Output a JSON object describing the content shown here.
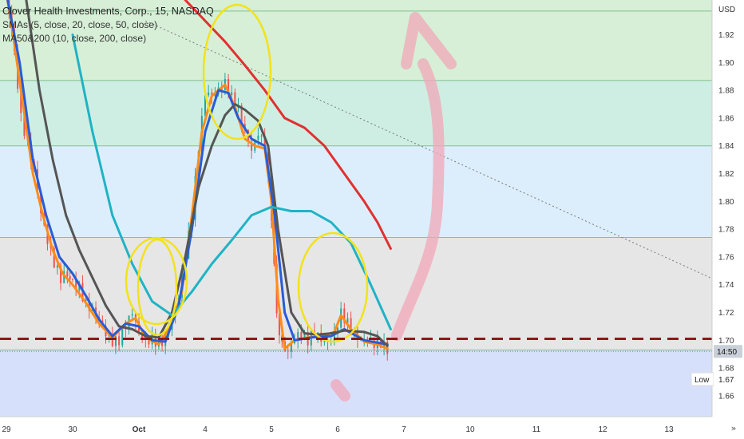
{
  "legend": {
    "symbol_line": "Clover Health Investments, Corp., 15, NASDAQ",
    "sma_line": "SMAs (5, close, 20, close, 50, close)",
    "ma_line": "MA50&200 (10, close, 200, close)"
  },
  "chart_data": {
    "type": "candlestick",
    "symbol": "Clover Health Investments, Corp.",
    "interval": "15",
    "exchange": "NASDAQ",
    "currency_label": "USD",
    "ylim": [
      1.645,
      1.945
    ],
    "y_ticks": [
      1.66,
      1.68,
      1.7,
      1.72,
      1.74,
      1.76,
      1.78,
      1.8,
      1.82,
      1.84,
      1.86,
      1.88,
      1.9,
      1.92
    ],
    "x_ticks": [
      {
        "label": "29",
        "day": 0,
        "bold": false
      },
      {
        "label": "30",
        "day": 1,
        "bold": false
      },
      {
        "label": "Oct",
        "day": 2,
        "bold": true
      },
      {
        "label": "4",
        "day": 3,
        "bold": false
      },
      {
        "label": "5",
        "day": 4,
        "bold": false
      },
      {
        "label": "6",
        "day": 5,
        "bold": false
      },
      {
        "label": "7",
        "day": 6,
        "bold": false
      },
      {
        "label": "10",
        "day": 7,
        "bold": false
      },
      {
        "label": "11",
        "day": 8,
        "bold": false
      },
      {
        "label": "12",
        "day": 9,
        "bold": false
      },
      {
        "label": "13",
        "day": 10,
        "bold": false
      }
    ],
    "zones": [
      {
        "from": 1.887,
        "to": 1.945,
        "color": "#d6efd6"
      },
      {
        "from": 1.84,
        "to": 1.887,
        "color": "#cfeee3"
      },
      {
        "from": 1.774,
        "to": 1.84,
        "color": "#dceefb"
      },
      {
        "from": 1.693,
        "to": 1.774,
        "color": "#e6e6e6"
      },
      {
        "from": 1.645,
        "to": 1.693,
        "color": "#d6e0fb"
      }
    ],
    "zone_lines": [
      1.937,
      1.887,
      1.84,
      1.774,
      1.693
    ],
    "support_level": 1.701,
    "current_price_label": "14:50",
    "current_price": 1.692,
    "low_label": "Low",
    "low_value": "1.67",
    "low_price": 1.672,
    "close_series": [
      [
        0.0,
        1.95
      ],
      [
        0.12,
        1.91
      ],
      [
        0.22,
        1.86
      ],
      [
        0.32,
        1.84
      ],
      [
        0.42,
        1.82
      ],
      [
        0.52,
        1.79
      ],
      [
        0.62,
        1.77
      ],
      [
        0.72,
        1.755
      ],
      [
        0.82,
        1.745
      ],
      [
        0.92,
        1.75
      ],
      [
        1.0,
        1.742
      ],
      [
        1.1,
        1.738
      ],
      [
        1.2,
        1.725
      ],
      [
        1.3,
        1.72
      ],
      [
        1.4,
        1.712
      ],
      [
        1.5,
        1.703
      ],
      [
        1.6,
        1.698
      ],
      [
        1.7,
        1.7
      ],
      [
        1.8,
        1.712
      ],
      [
        1.9,
        1.722
      ],
      [
        2.0,
        1.708
      ],
      [
        2.1,
        1.7
      ],
      [
        2.2,
        1.702
      ],
      [
        2.3,
        1.696
      ],
      [
        2.4,
        1.7
      ],
      [
        2.5,
        1.715
      ],
      [
        2.6,
        1.73
      ],
      [
        2.7,
        1.76
      ],
      [
        2.8,
        1.79
      ],
      [
        2.9,
        1.84
      ],
      [
        3.0,
        1.88
      ],
      [
        3.1,
        1.878
      ],
      [
        3.2,
        1.882
      ],
      [
        3.3,
        1.886
      ],
      [
        3.4,
        1.875
      ],
      [
        3.5,
        1.865
      ],
      [
        3.6,
        1.848
      ],
      [
        3.7,
        1.835
      ],
      [
        3.8,
        1.848
      ],
      [
        3.9,
        1.838
      ],
      [
        4.0,
        1.79
      ],
      [
        4.08,
        1.72
      ],
      [
        4.16,
        1.695
      ],
      [
        4.25,
        1.69
      ],
      [
        4.35,
        1.7
      ],
      [
        4.45,
        1.704
      ],
      [
        4.55,
        1.7
      ],
      [
        4.65,
        1.708
      ],
      [
        4.75,
        1.702
      ],
      [
        4.85,
        1.7
      ],
      [
        4.95,
        1.706
      ],
      [
        5.05,
        1.72
      ],
      [
        5.15,
        1.712
      ],
      [
        5.25,
        1.702
      ],
      [
        5.35,
        1.698
      ],
      [
        5.45,
        1.7
      ],
      [
        5.55,
        1.696
      ],
      [
        5.65,
        1.698
      ],
      [
        5.75,
        1.694
      ]
    ],
    "series": [
      {
        "name": "SMA 5",
        "color": "#ff8c1a",
        "points": [
          [
            0.0,
            1.95
          ],
          [
            0.1,
            1.92
          ],
          [
            0.25,
            1.87
          ],
          [
            0.4,
            1.82
          ],
          [
            0.55,
            1.79
          ],
          [
            0.7,
            1.765
          ],
          [
            0.85,
            1.748
          ],
          [
            1.0,
            1.74
          ],
          [
            1.2,
            1.727
          ],
          [
            1.4,
            1.712
          ],
          [
            1.6,
            1.702
          ],
          [
            1.8,
            1.712
          ],
          [
            1.95,
            1.716
          ],
          [
            2.1,
            1.702
          ],
          [
            2.3,
            1.697
          ],
          [
            2.5,
            1.712
          ],
          [
            2.65,
            1.735
          ],
          [
            2.8,
            1.79
          ],
          [
            2.95,
            1.85
          ],
          [
            3.1,
            1.876
          ],
          [
            3.3,
            1.884
          ],
          [
            3.45,
            1.868
          ],
          [
            3.6,
            1.845
          ],
          [
            3.75,
            1.84
          ],
          [
            3.9,
            1.838
          ],
          [
            4.0,
            1.8
          ],
          [
            4.1,
            1.73
          ],
          [
            4.2,
            1.694
          ],
          [
            4.35,
            1.7
          ],
          [
            4.55,
            1.702
          ],
          [
            4.75,
            1.703
          ],
          [
            4.95,
            1.706
          ],
          [
            5.05,
            1.718
          ],
          [
            5.2,
            1.708
          ],
          [
            5.4,
            1.699
          ],
          [
            5.6,
            1.697
          ],
          [
            5.75,
            1.694
          ]
        ]
      },
      {
        "name": "SMA 20",
        "color": "#2a5bd7",
        "points": [
          [
            0.0,
            1.95
          ],
          [
            0.2,
            1.9
          ],
          [
            0.4,
            1.83
          ],
          [
            0.6,
            1.79
          ],
          [
            0.8,
            1.76
          ],
          [
            1.0,
            1.748
          ],
          [
            1.2,
            1.732
          ],
          [
            1.4,
            1.715
          ],
          [
            1.6,
            1.703
          ],
          [
            1.8,
            1.712
          ],
          [
            2.0,
            1.71
          ],
          [
            2.2,
            1.7
          ],
          [
            2.4,
            1.699
          ],
          [
            2.6,
            1.725
          ],
          [
            2.8,
            1.78
          ],
          [
            3.0,
            1.85
          ],
          [
            3.2,
            1.88
          ],
          [
            3.35,
            1.878
          ],
          [
            3.5,
            1.86
          ],
          [
            3.7,
            1.845
          ],
          [
            3.9,
            1.84
          ],
          [
            4.05,
            1.79
          ],
          [
            4.2,
            1.72
          ],
          [
            4.35,
            1.7
          ],
          [
            4.6,
            1.702
          ],
          [
            4.9,
            1.703
          ],
          [
            5.1,
            1.708
          ],
          [
            5.4,
            1.7
          ],
          [
            5.75,
            1.697
          ]
        ]
      },
      {
        "name": "SMA 50",
        "color": "#555555",
        "points": [
          [
            0.3,
            1.945
          ],
          [
            0.5,
            1.88
          ],
          [
            0.7,
            1.83
          ],
          [
            0.9,
            1.79
          ],
          [
            1.1,
            1.765
          ],
          [
            1.3,
            1.745
          ],
          [
            1.5,
            1.725
          ],
          [
            1.7,
            1.71
          ],
          [
            1.9,
            1.708
          ],
          [
            2.1,
            1.703
          ],
          [
            2.3,
            1.702
          ],
          [
            2.5,
            1.72
          ],
          [
            2.7,
            1.76
          ],
          [
            2.9,
            1.81
          ],
          [
            3.1,
            1.84
          ],
          [
            3.3,
            1.862
          ],
          [
            3.45,
            1.87
          ],
          [
            3.6,
            1.866
          ],
          [
            3.8,
            1.858
          ],
          [
            3.95,
            1.84
          ],
          [
            4.1,
            1.78
          ],
          [
            4.3,
            1.72
          ],
          [
            4.5,
            1.705
          ],
          [
            4.7,
            1.704
          ],
          [
            4.9,
            1.705
          ],
          [
            5.1,
            1.707
          ],
          [
            5.4,
            1.706
          ],
          [
            5.6,
            1.703
          ],
          [
            5.75,
            1.696
          ]
        ]
      },
      {
        "name": "MA 10",
        "color": "#1fb3c4",
        "points": [
          [
            1.0,
            1.92
          ],
          [
            1.3,
            1.85
          ],
          [
            1.6,
            1.79
          ],
          [
            1.9,
            1.755
          ],
          [
            2.2,
            1.728
          ],
          [
            2.5,
            1.718
          ],
          [
            2.8,
            1.735
          ],
          [
            3.1,
            1.755
          ],
          [
            3.4,
            1.772
          ],
          [
            3.7,
            1.79
          ],
          [
            4.0,
            1.796
          ],
          [
            4.3,
            1.793
          ],
          [
            4.6,
            1.793
          ],
          [
            4.9,
            1.785
          ],
          [
            5.2,
            1.77
          ],
          [
            5.5,
            1.74
          ],
          [
            5.8,
            1.708
          ]
        ]
      },
      {
        "name": "MA 200",
        "color": "#e03131",
        "points": [
          [
            2.7,
            1.945
          ],
          [
            3.0,
            1.93
          ],
          [
            3.3,
            1.915
          ],
          [
            3.6,
            1.898
          ],
          [
            3.9,
            1.88
          ],
          [
            4.2,
            1.86
          ],
          [
            4.5,
            1.853
          ],
          [
            4.8,
            1.84
          ],
          [
            5.1,
            1.82
          ],
          [
            5.4,
            1.8
          ],
          [
            5.6,
            1.785
          ],
          [
            5.8,
            1.766
          ]
        ]
      }
    ],
    "trendline": {
      "x0": 2.1,
      "y0": 1.93,
      "x1": 10.95,
      "y1": 1.738
    }
  }
}
